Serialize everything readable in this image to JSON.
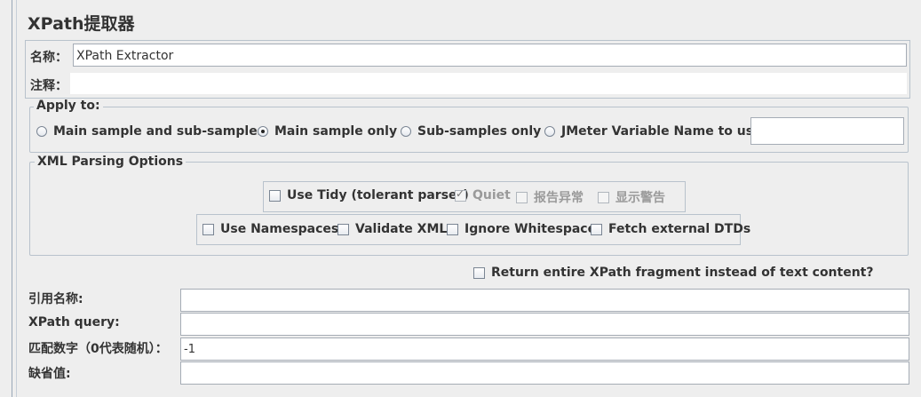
{
  "title": "XPath提取器",
  "name_label": "名称：",
  "name_value": "XPath Extractor",
  "comment_label": "注释：",
  "comment_value": "",
  "apply_to": {
    "legend": "Apply to:",
    "options": [
      {
        "label": "Main sample and sub-samples",
        "selected": false
      },
      {
        "label": "Main sample only",
        "selected": true
      },
      {
        "label": "Sub-samples only",
        "selected": false
      },
      {
        "label": "JMeter Variable Name to use",
        "selected": false
      }
    ],
    "variable_value": ""
  },
  "xml_parsing": {
    "legend": "XML Parsing Options",
    "row1": [
      {
        "label": "Use Tidy (tolerant parser)",
        "checked": false,
        "enabled": true
      },
      {
        "label": "Quiet",
        "checked": true,
        "enabled": false
      },
      {
        "label": "报告异常",
        "checked": false,
        "enabled": false
      },
      {
        "label": "显示警告",
        "checked": false,
        "enabled": false
      }
    ],
    "row2": [
      {
        "label": "Use Namespaces",
        "checked": false,
        "enabled": true
      },
      {
        "label": "Validate XML",
        "checked": false,
        "enabled": true
      },
      {
        "label": "Ignore Whitespace",
        "checked": false,
        "enabled": true
      },
      {
        "label": "Fetch external DTDs",
        "checked": false,
        "enabled": true
      }
    ]
  },
  "return_fragment": {
    "label": "Return entire XPath fragment instead of text content?",
    "checked": false
  },
  "fields": {
    "ref_name_label": "引用名称:",
    "ref_name_value": "",
    "xpath_query_label": "XPath query:",
    "xpath_query_value": "",
    "match_no_label": "匹配数字（0代表随机）：",
    "match_no_value": "-1",
    "default_label": "缺省值:",
    "default_value": ""
  }
}
